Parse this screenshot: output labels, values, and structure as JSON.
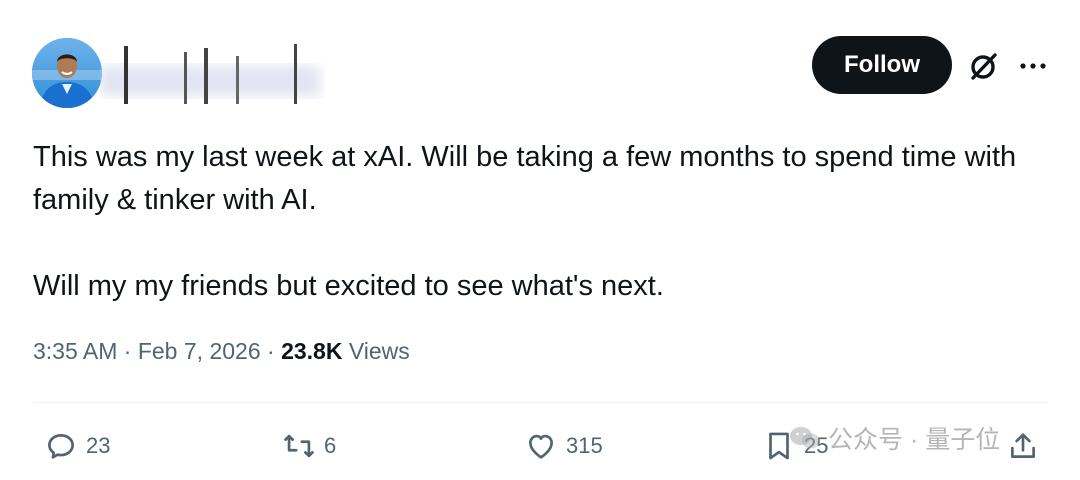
{
  "header": {
    "follow_label": "Follow",
    "avatar_icon": "profile-photo",
    "grok_icon": "grok-slash-circle-icon",
    "more_icon": "more-dots-icon"
  },
  "tweet": {
    "paragraphs": [
      "This was my last week at xAI. Will be taking a few months to spend time with family & tinker with AI.",
      "Will my my friends but excited to see what's next."
    ],
    "time": "3:35 AM",
    "date": "Feb 7, 2026",
    "separator": "·",
    "views_count": "23.8K",
    "views_label": "Views"
  },
  "actions": {
    "replies": "23",
    "reposts": "6",
    "likes": "315",
    "bookmarks": "25"
  },
  "watermark": {
    "text": "公众号 · 量子位"
  },
  "colors": {
    "text": "#0f1419",
    "muted": "#536471",
    "button_bg": "#0f1419"
  }
}
